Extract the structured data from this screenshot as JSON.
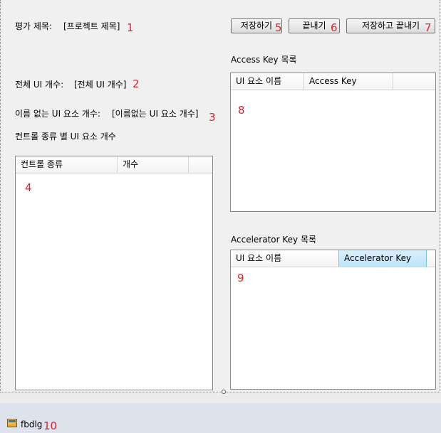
{
  "form": {
    "eval_title_label": "평가 제목:",
    "eval_title_value": "[프로젝트 제목]",
    "total_ui_label": "전체 UI 개수:",
    "total_ui_value": "[전체 UI 개수]",
    "unnamed_ui_label": "이름 없는 UI 요소 개수:",
    "unnamed_ui_value": "[이름없는 UI 요소 개수]",
    "control_type_section": "컨트롤 종류 별 UI 요소 개수",
    "access_key_section": "Access Key 목록",
    "accelerator_key_section": "Accelerator Key 목록"
  },
  "buttons": {
    "save": "저장하기",
    "close": "끝내기",
    "save_close": "저장하고 끝내기"
  },
  "control_type_list": {
    "columns": [
      "컨트롤 종류",
      "개수"
    ]
  },
  "access_key_list": {
    "columns": [
      "UI 요소 이름",
      "Access Key"
    ]
  },
  "accelerator_key_list": {
    "columns": [
      "UI 요소 이름",
      "Accelerator Key"
    ]
  },
  "annotations": [
    "1",
    "2",
    "3",
    "4",
    "5",
    "6",
    "7",
    "8",
    "9",
    "10"
  ],
  "component_tray": {
    "item_label": "fbdlg"
  }
}
